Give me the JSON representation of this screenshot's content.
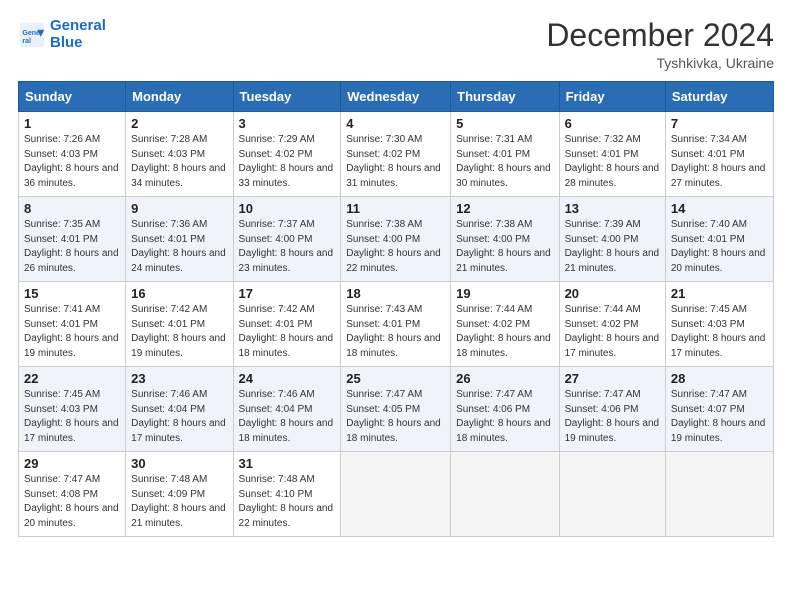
{
  "logo": {
    "line1": "General",
    "line2": "Blue"
  },
  "title": "December 2024",
  "location": "Tyshkivka, Ukraine",
  "days_of_week": [
    "Sunday",
    "Monday",
    "Tuesday",
    "Wednesday",
    "Thursday",
    "Friday",
    "Saturday"
  ],
  "weeks": [
    [
      {
        "day": "1",
        "sunrise": "7:26 AM",
        "sunset": "4:03 PM",
        "daylight": "8 hours and 36 minutes."
      },
      {
        "day": "2",
        "sunrise": "7:28 AM",
        "sunset": "4:03 PM",
        "daylight": "8 hours and 34 minutes."
      },
      {
        "day": "3",
        "sunrise": "7:29 AM",
        "sunset": "4:02 PM",
        "daylight": "8 hours and 33 minutes."
      },
      {
        "day": "4",
        "sunrise": "7:30 AM",
        "sunset": "4:02 PM",
        "daylight": "8 hours and 31 minutes."
      },
      {
        "day": "5",
        "sunrise": "7:31 AM",
        "sunset": "4:01 PM",
        "daylight": "8 hours and 30 minutes."
      },
      {
        "day": "6",
        "sunrise": "7:32 AM",
        "sunset": "4:01 PM",
        "daylight": "8 hours and 28 minutes."
      },
      {
        "day": "7",
        "sunrise": "7:34 AM",
        "sunset": "4:01 PM",
        "daylight": "8 hours and 27 minutes."
      }
    ],
    [
      {
        "day": "8",
        "sunrise": "7:35 AM",
        "sunset": "4:01 PM",
        "daylight": "8 hours and 26 minutes."
      },
      {
        "day": "9",
        "sunrise": "7:36 AM",
        "sunset": "4:01 PM",
        "daylight": "8 hours and 24 minutes."
      },
      {
        "day": "10",
        "sunrise": "7:37 AM",
        "sunset": "4:00 PM",
        "daylight": "8 hours and 23 minutes."
      },
      {
        "day": "11",
        "sunrise": "7:38 AM",
        "sunset": "4:00 PM",
        "daylight": "8 hours and 22 minutes."
      },
      {
        "day": "12",
        "sunrise": "7:38 AM",
        "sunset": "4:00 PM",
        "daylight": "8 hours and 21 minutes."
      },
      {
        "day": "13",
        "sunrise": "7:39 AM",
        "sunset": "4:00 PM",
        "daylight": "8 hours and 21 minutes."
      },
      {
        "day": "14",
        "sunrise": "7:40 AM",
        "sunset": "4:01 PM",
        "daylight": "8 hours and 20 minutes."
      }
    ],
    [
      {
        "day": "15",
        "sunrise": "7:41 AM",
        "sunset": "4:01 PM",
        "daylight": "8 hours and 19 minutes."
      },
      {
        "day": "16",
        "sunrise": "7:42 AM",
        "sunset": "4:01 PM",
        "daylight": "8 hours and 19 minutes."
      },
      {
        "day": "17",
        "sunrise": "7:42 AM",
        "sunset": "4:01 PM",
        "daylight": "8 hours and 18 minutes."
      },
      {
        "day": "18",
        "sunrise": "7:43 AM",
        "sunset": "4:01 PM",
        "daylight": "8 hours and 18 minutes."
      },
      {
        "day": "19",
        "sunrise": "7:44 AM",
        "sunset": "4:02 PM",
        "daylight": "8 hours and 18 minutes."
      },
      {
        "day": "20",
        "sunrise": "7:44 AM",
        "sunset": "4:02 PM",
        "daylight": "8 hours and 17 minutes."
      },
      {
        "day": "21",
        "sunrise": "7:45 AM",
        "sunset": "4:03 PM",
        "daylight": "8 hours and 17 minutes."
      }
    ],
    [
      {
        "day": "22",
        "sunrise": "7:45 AM",
        "sunset": "4:03 PM",
        "daylight": "8 hours and 17 minutes."
      },
      {
        "day": "23",
        "sunrise": "7:46 AM",
        "sunset": "4:04 PM",
        "daylight": "8 hours and 17 minutes."
      },
      {
        "day": "24",
        "sunrise": "7:46 AM",
        "sunset": "4:04 PM",
        "daylight": "8 hours and 18 minutes."
      },
      {
        "day": "25",
        "sunrise": "7:47 AM",
        "sunset": "4:05 PM",
        "daylight": "8 hours and 18 minutes."
      },
      {
        "day": "26",
        "sunrise": "7:47 AM",
        "sunset": "4:06 PM",
        "daylight": "8 hours and 18 minutes."
      },
      {
        "day": "27",
        "sunrise": "7:47 AM",
        "sunset": "4:06 PM",
        "daylight": "8 hours and 19 minutes."
      },
      {
        "day": "28",
        "sunrise": "7:47 AM",
        "sunset": "4:07 PM",
        "daylight": "8 hours and 19 minutes."
      }
    ],
    [
      {
        "day": "29",
        "sunrise": "7:47 AM",
        "sunset": "4:08 PM",
        "daylight": "8 hours and 20 minutes."
      },
      {
        "day": "30",
        "sunrise": "7:48 AM",
        "sunset": "4:09 PM",
        "daylight": "8 hours and 21 minutes."
      },
      {
        "day": "31",
        "sunrise": "7:48 AM",
        "sunset": "4:10 PM",
        "daylight": "8 hours and 22 minutes."
      },
      null,
      null,
      null,
      null
    ]
  ]
}
